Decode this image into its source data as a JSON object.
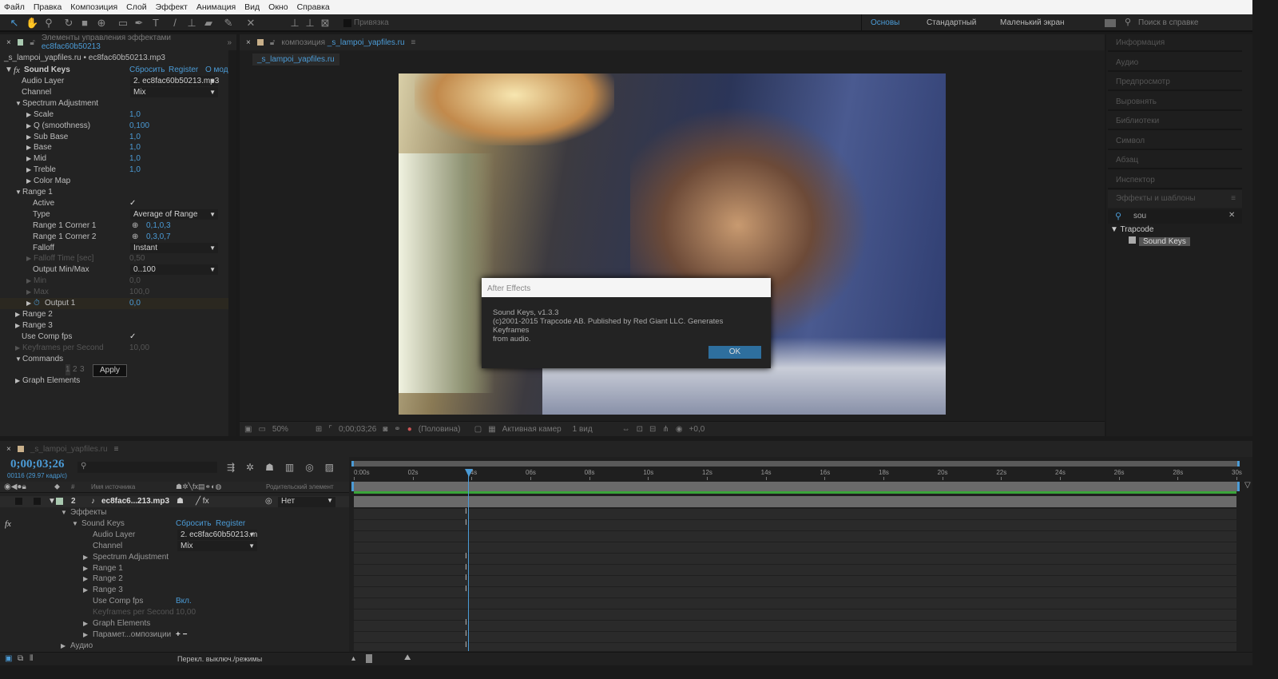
{
  "menu": [
    "Файл",
    "Правка",
    "Композиция",
    "Слой",
    "Эффект",
    "Анимация",
    "Вид",
    "Окно",
    "Справка"
  ],
  "toolbar": {
    "snap_label": "Привязка",
    "workspaces": [
      "Основы",
      "Стандартный",
      "Маленький экран"
    ],
    "help_search_placeholder": "Поиск в справке"
  },
  "effects_panel": {
    "tab_title": "Элементы управления эффектами",
    "tab_layer": "ec8fac60b50213",
    "breadcrumb": "_s_lampoi_yapfiles.ru • ec8fac60b50213.mp3",
    "effect_name": "Sound Keys",
    "reset": "Сбросить",
    "register": "Register",
    "about": "О мод",
    "rows": [
      {
        "label": "Audio Layer",
        "indent": 1,
        "dropdown": "2. ec8fac60b50213.mp3"
      },
      {
        "label": "Channel",
        "indent": 1,
        "dropdown": "Mix"
      },
      {
        "label": "Spectrum Adjustment",
        "indent": 1,
        "arrow": "open"
      },
      {
        "label": "Scale",
        "indent": 2,
        "arrow": "closed",
        "value": "1,0"
      },
      {
        "label": "Q (smoothness)",
        "indent": 2,
        "arrow": "closed",
        "value": "0,100"
      },
      {
        "label": "Sub Base",
        "indent": 2,
        "arrow": "closed",
        "value": "1,0"
      },
      {
        "label": "Base",
        "indent": 2,
        "arrow": "closed",
        "value": "1,0"
      },
      {
        "label": "Mid",
        "indent": 2,
        "arrow": "closed",
        "value": "1,0"
      },
      {
        "label": "Treble",
        "indent": 2,
        "arrow": "closed",
        "value": "1,0"
      },
      {
        "label": "Color Map",
        "indent": 2,
        "arrow": "closed"
      },
      {
        "label": "Range 1",
        "indent": 1,
        "arrow": "open"
      },
      {
        "label": "Active",
        "indent": 2,
        "check": "✓"
      },
      {
        "label": "Type",
        "indent": 2,
        "dropdown": "Average of Range"
      },
      {
        "label": "Range 1 Corner 1",
        "indent": 2,
        "point": "0,1,0,3"
      },
      {
        "label": "Range 1 Corner 2",
        "indent": 2,
        "point": "0,3,0,7"
      },
      {
        "label": "Falloff",
        "indent": 2,
        "dropdown": "Instant"
      },
      {
        "label": "Falloff Time [sec]",
        "indent": 2,
        "arrow": "closed",
        "value": "0,50",
        "dim": true
      },
      {
        "label": "Output Min/Max",
        "indent": 2,
        "dropdown": "0..100"
      },
      {
        "label": "Min",
        "indent": 2,
        "arrow": "closed",
        "value": "0,0",
        "dim": true
      },
      {
        "label": "Max",
        "indent": 2,
        "arrow": "closed",
        "value": "100,0",
        "dim": true
      },
      {
        "label": "Output 1",
        "indent": 2,
        "arrow": "closed",
        "value": "0,0",
        "stopwatch": true
      },
      {
        "label": "Range 2",
        "indent": 1,
        "arrow": "closed"
      },
      {
        "label": "Range 3",
        "indent": 1,
        "arrow": "closed"
      },
      {
        "label": "Use Comp fps",
        "indent": 1,
        "check": "✓"
      },
      {
        "label": "Keyframes per Second",
        "indent": 1,
        "arrow": "closed",
        "value": "10,00",
        "dim": true
      },
      {
        "label": "Commands",
        "indent": 1,
        "arrow": "open"
      },
      {
        "label": "",
        "indent": 1,
        "commands": [
          "1",
          "2",
          "3"
        ],
        "apply": "Apply"
      },
      {
        "label": "Graph Elements",
        "indent": 1,
        "arrow": "closed"
      }
    ]
  },
  "comp_panel": {
    "tab_prefix": "композиция",
    "comp_name": "_s_lampoi_yapfiles.ru",
    "sub_tab": "_s_lampoi_yapfiles.ru",
    "zoom": "50%",
    "timecode": "0;00;03;26",
    "resolution": "(Половина)",
    "camera": "Активная камер",
    "views": "1 вид",
    "exposure": "+0,0"
  },
  "dialog": {
    "title": "After Effects",
    "line1": "Sound Keys, v1.3.3",
    "line2": "(c)2001-2015 Trapcode AB. Published by Red Giant LLC. Generates Keyframes",
    "line3": "from audio.",
    "ok": "OK"
  },
  "right_panel": {
    "items": [
      "Информация",
      "Аудио",
      "Предпросмотр",
      "Выровнять",
      "Библиотеки",
      "Символ",
      "Абзац",
      "Инспектор"
    ],
    "effects_title": "Эффекты и шаблоны",
    "search_value": "sou",
    "category": "Trapcode",
    "result": "Sound Keys"
  },
  "timeline": {
    "tab": "_s_lampoi_yapfiles.ru",
    "timecode": "0;00;03;26",
    "frame_info": "00116 (29.97 кадр/с)",
    "search_placeholder": "",
    "col_num": "#",
    "col_source": "Имя источника",
    "col_parent": "Родительский элемент",
    "layer": {
      "num": "2",
      "name": "ec8fac6...213.mp3",
      "parent": "Нет"
    },
    "rows": [
      {
        "label": "Эффекты",
        "indent": 0,
        "arrow": "open"
      },
      {
        "label": "Sound Keys",
        "indent": 1,
        "arrow": "open",
        "reset": "Сбросить",
        "register": "Register",
        "fx": "fx"
      },
      {
        "label": "Audio Layer",
        "indent": 2,
        "dropdown": "2. ec8fac60b50213.m"
      },
      {
        "label": "Channel",
        "indent": 2,
        "dropdown": "Mix"
      },
      {
        "label": "Spectrum Adjustment",
        "indent": 2,
        "arrow": "closed",
        "kf": true
      },
      {
        "label": "Range 1",
        "indent": 2,
        "arrow": "closed",
        "kf": true
      },
      {
        "label": "Range 2",
        "indent": 2,
        "arrow": "closed",
        "kf": true
      },
      {
        "label": "Range 3",
        "indent": 2,
        "arrow": "closed",
        "kf": true
      },
      {
        "label": "Use Comp fps",
        "indent": 2,
        "value": "Вкл."
      },
      {
        "label": "Keyframes per Second",
        "indent": 2,
        "value": "10,00",
        "dim": true
      },
      {
        "label": "Graph Elements",
        "indent": 2,
        "arrow": "closed",
        "kf": true
      },
      {
        "label": "Парамет...омпозиции",
        "indent": 2,
        "arrow": "closed",
        "plusminus": "+ −",
        "kf": true
      },
      {
        "label": "Аудио",
        "indent": 0,
        "arrow": "closed",
        "kf": true
      }
    ],
    "ruler": [
      "0:00s",
      "02s",
      "04s",
      "06s",
      "08s",
      "10s",
      "12s",
      "14s",
      "16s",
      "18s",
      "20s",
      "22s",
      "24s",
      "26s",
      "28s",
      "30s"
    ],
    "duration_sec": 30,
    "current_time_sec": 3.87,
    "status_toggle": "Перекл. выключ./режимы"
  },
  "colors": {
    "accent": "#4b9bd6",
    "ok_button": "#2e6f9e",
    "audio_bar": "#3aa53a"
  }
}
